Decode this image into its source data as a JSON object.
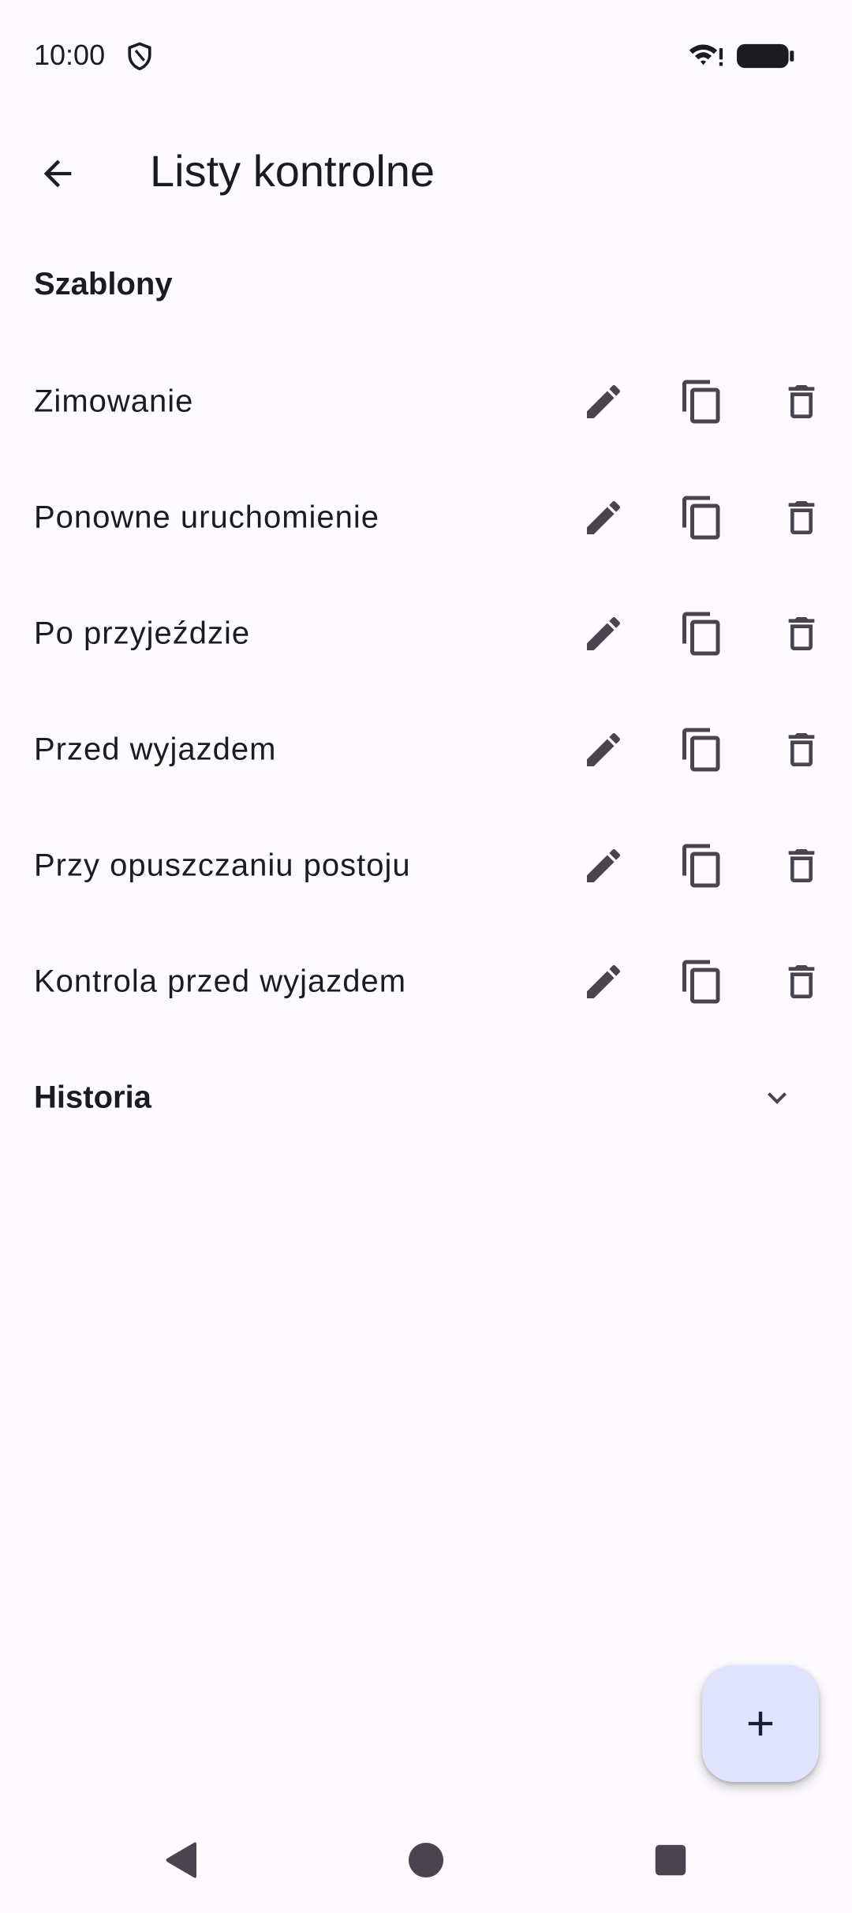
{
  "status_bar": {
    "time": "10:00"
  },
  "app_bar": {
    "title": "Listy kontrolne"
  },
  "sections": {
    "templates_header": "Szablony",
    "history_header": "Historia"
  },
  "templates": [
    {
      "label": "Zimowanie"
    },
    {
      "label": "Ponowne uruchomienie"
    },
    {
      "label": "Po przyjeździe"
    },
    {
      "label": "Przed wyjazdem"
    },
    {
      "label": "Przy opuszczaniu postoju"
    },
    {
      "label": "Kontrola przed wyjazdem"
    }
  ],
  "row_actions": {
    "edit_icon": "pencil-icon",
    "copy_icon": "copy-icon",
    "delete_icon": "trash-icon"
  },
  "colors": {
    "background": "#fdfbfe",
    "text": "#1c1b1f",
    "icon": "#49454f",
    "fab_background": "#dfe3fb"
  }
}
